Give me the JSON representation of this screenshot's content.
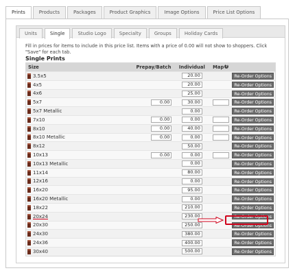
{
  "outer_tabs": [
    "Prints",
    "Products",
    "Packages",
    "Product Graphics",
    "Image Options",
    "Price List Options"
  ],
  "inner_tabs": [
    "Units",
    "Single",
    "Studio Logo",
    "Specialty",
    "Groups",
    "Holiday Cards"
  ],
  "instructions": "Fill in prices for items to include in this price list. Items with a price of 0.00 will not show to shoppers. Click \"Save\" for each tab.",
  "section_title": "Single Prints",
  "columns": {
    "size": "Size",
    "prepay": "Prepay/Batch",
    "individual": "Individual",
    "map": "Map"
  },
  "reorder_label": "Re-Order Options",
  "rows": [
    {
      "size": "3.5x5",
      "prepay": null,
      "individual": "20.00",
      "map": null
    },
    {
      "size": "4x5",
      "prepay": null,
      "individual": "20.00",
      "map": null
    },
    {
      "size": "4x6",
      "prepay": null,
      "individual": "25.00",
      "map": null
    },
    {
      "size": "5x7",
      "prepay": "0.00",
      "individual": "30.00",
      "map": ""
    },
    {
      "size": "5x7 Metallic",
      "prepay": null,
      "individual": "0.00",
      "map": null
    },
    {
      "size": "7x10",
      "prepay": "0.00",
      "individual": "0.00",
      "map": ""
    },
    {
      "size": "8x10",
      "prepay": "0.00",
      "individual": "40.00",
      "map": ""
    },
    {
      "size": "8x10 Metallic",
      "prepay": "0.00",
      "individual": "0.00",
      "map": ""
    },
    {
      "size": "8x12",
      "prepay": null,
      "individual": "50.00",
      "map": null
    },
    {
      "size": "10x13",
      "prepay": "0.00",
      "individual": "0.00",
      "map": ""
    },
    {
      "size": "10x13 Metallic",
      "prepay": null,
      "individual": "0.00",
      "map": null
    },
    {
      "size": "11x14",
      "prepay": null,
      "individual": "80.00",
      "map": null
    },
    {
      "size": "12x16",
      "prepay": null,
      "individual": "0.00",
      "map": null
    },
    {
      "size": "16x20",
      "prepay": null,
      "individual": "95.00",
      "map": null
    },
    {
      "size": "16x20 Metallic",
      "prepay": null,
      "individual": "0.00",
      "map": null
    },
    {
      "size": "18x22",
      "prepay": null,
      "individual": "210.00",
      "map": null
    },
    {
      "size": "20x24",
      "prepay": null,
      "individual": "230.00",
      "map": null,
      "highlight": true
    },
    {
      "size": "20x30",
      "prepay": null,
      "individual": "250.00",
      "map": null
    },
    {
      "size": "24x30",
      "prepay": null,
      "individual": "380.00",
      "map": null
    },
    {
      "size": "24x36",
      "prepay": null,
      "individual": "400.00",
      "map": null
    },
    {
      "size": "30x40",
      "prepay": null,
      "individual": "500.00",
      "map": null
    }
  ],
  "colors": {
    "annotation": "#d0021b",
    "button": "#6c6c6c",
    "header": "#d6d6d6"
  }
}
